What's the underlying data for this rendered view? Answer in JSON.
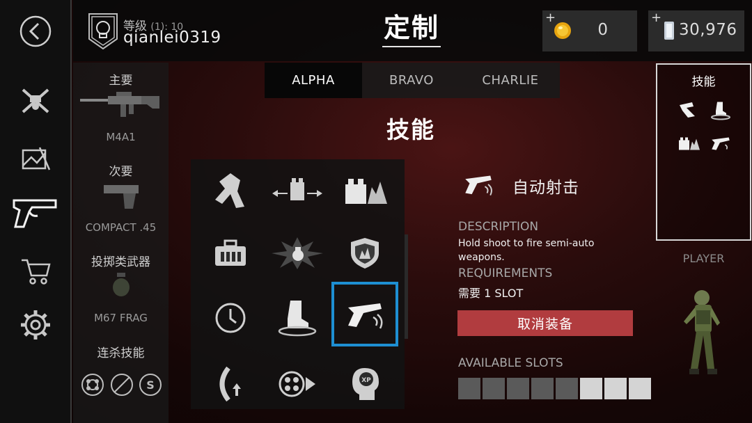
{
  "nav": {
    "icons": [
      "back-arrow-icon",
      "crossed-rifles-icon",
      "map-icon",
      "pistol-icon",
      "cart-icon",
      "gear-icon"
    ]
  },
  "header": {
    "level_label": "等级",
    "level_value": "(1): 10",
    "username": "qianlei0319",
    "title": "定制",
    "gold": {
      "plus": "+",
      "value": "0"
    },
    "silver": {
      "plus": "+",
      "value": "30,976"
    }
  },
  "loadout": {
    "primary_label": "主要",
    "primary_name": "M4A1",
    "secondary_label": "次要",
    "secondary_name": "COMPACT .45",
    "throwable_label": "投掷类武器",
    "throwable_name": "M67 FRAG",
    "killstreak_label": "连杀技能"
  },
  "tabs": [
    {
      "label": "ALPHA",
      "active": true
    },
    {
      "label": "BRAVO",
      "active": false
    },
    {
      "label": "CHARLIE",
      "active": false
    }
  ],
  "section_title": "技能",
  "grid": {
    "icons": [
      "dash-icon",
      "width-arrows-icon",
      "shock-wall-icon",
      "ammo-case-icon",
      "explosion-icon",
      "shield-flame-icon",
      "clock-icon",
      "stomp-icon",
      "auto-fire-pistol-icon",
      "reload-arc-icon",
      "drone-forward-icon",
      "xp-head-icon"
    ],
    "selected_index": 8
  },
  "detail": {
    "name": "自动射击",
    "description_label": "DESCRIPTION",
    "description": "Hold shoot to fire semi-auto weapons.",
    "requirements_label": "REQUIREMENTS",
    "requirements": "需要 1 SLOT",
    "unequip_label": "取消装备",
    "slots_label": "AVAILABLE SLOTS",
    "slots_total": 8,
    "slots_used": 5
  },
  "right": {
    "skills_label": "技能",
    "player_label": "PLAYER"
  },
  "colors": {
    "accent_blue": "#1e8fd2",
    "unequip_red": "#b13c3f",
    "slot_used": "#5a5a5a",
    "slot_free": "#d4d4d4"
  }
}
